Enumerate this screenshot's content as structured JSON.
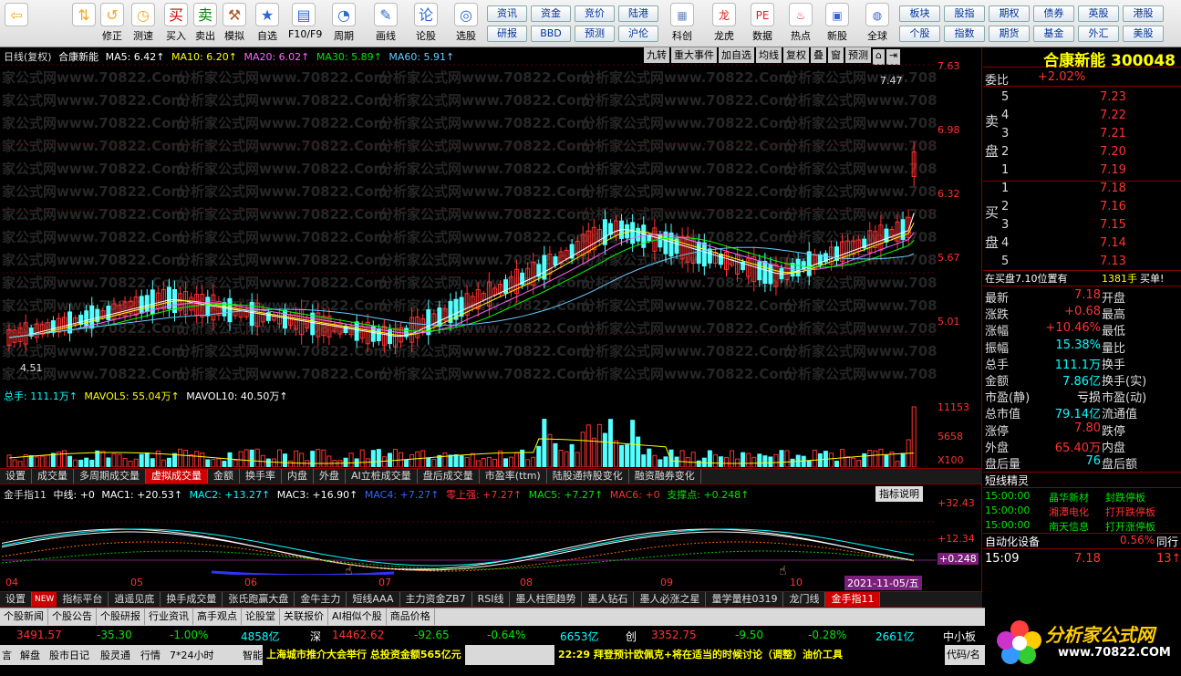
{
  "toolbar": {
    "main_buttons": [
      {
        "label": "",
        "icon": "back-arrow-icon"
      },
      {
        "label": "",
        "icon": "up-down-arrow-icon"
      },
      {
        "label": "修正",
        "icon": "fix-icon"
      },
      {
        "label": "测速",
        "icon": "clock-icon"
      },
      {
        "label": "买入",
        "icon": "buy-icon"
      },
      {
        "label": "卖出",
        "icon": "sell-icon"
      },
      {
        "label": "模拟",
        "icon": "hammer-icon"
      },
      {
        "label": "自选",
        "icon": "star-icon"
      },
      {
        "label": "F10/F9",
        "icon": "f10-icon"
      },
      {
        "label": "周期",
        "icon": "period-icon"
      },
      {
        "label": "画线",
        "icon": "pencil-icon"
      },
      {
        "label": "论股",
        "icon": "discuss-icon"
      },
      {
        "label": "选股",
        "icon": "select-icon"
      }
    ],
    "grid1": [
      [
        "资讯",
        "资金",
        "竞价",
        "陆港"
      ],
      [
        "研报",
        "BBD",
        "预测",
        "沪伦"
      ]
    ],
    "mid_buttons": [
      {
        "label": "科创",
        "icon": "kechuang-icon"
      },
      {
        "label": "龙虎",
        "icon": "dragon-icon"
      },
      {
        "label": "数据",
        "icon": "pe-icon"
      },
      {
        "label": "热点",
        "icon": "hot-icon"
      },
      {
        "label": "新股",
        "icon": "newstock-icon"
      },
      {
        "label": "全球",
        "icon": "globe-icon"
      }
    ],
    "grid2": [
      [
        "板块",
        "股指",
        "期权",
        "债券",
        "英股",
        "港股"
      ],
      [
        "个股",
        "指数",
        "期货",
        "基金",
        "外汇",
        "美股"
      ]
    ]
  },
  "chart_header": {
    "mode": "日线(复权)",
    "name": "合康新能",
    "ma5": "MA5: 6.42↑",
    "ma10": "MA10: 6.20↑",
    "ma20": "MA20: 6.02↑",
    "ma30": "MA30: 5.89↑",
    "ma60": "MA60: 5.91↑"
  },
  "chart_toolbar": [
    "九转",
    "重大事件",
    "加自选",
    "均线",
    "复权",
    "叠",
    "窗",
    "预测"
  ],
  "price_axis": [
    "7.63",
    "6.98",
    "6.32",
    "5.67",
    "5.01"
  ],
  "price_labels": {
    "high": "7.47",
    "low": "4.51"
  },
  "volume_header": {
    "total": "总手: 111.1万↑",
    "mavol5": "MAVOL5: 55.04万↑",
    "mavol10": "MAVOL10: 40.50万↑"
  },
  "volume_axis": [
    "11153",
    "5658",
    "X100"
  ],
  "tabs1": [
    "设置",
    "成交量",
    "多周期成交量",
    "虚拟成交量",
    "金额",
    "换手率",
    "内盘",
    "外盘",
    "AI立桩成交量",
    "盘后成交量",
    "市盈率(ttm)",
    "陆股通持股变化",
    "融资融券变化"
  ],
  "tabs1_active": "虚拟成交量",
  "indicator_header": {
    "name": "金手指11",
    "mid": "中线: +0",
    "mac1": "MAC1: +20.53↑",
    "mac2": "MAC2: +13.27↑",
    "mac3": "MAC3: +16.90↑",
    "mac4": "MAC4: +7.27↑",
    "zero": "零上强: +7.27↑",
    "mac5": "MAC5: +7.27↑",
    "mac6": "MAC6: +0",
    "support": "支撑点: +0.248↑",
    "explain": "指标说明"
  },
  "indicator_axis": [
    "+32.43",
    "+12.34",
    "+0.248"
  ],
  "months": [
    "04",
    "05",
    "06",
    "07",
    "08",
    "09",
    "10"
  ],
  "current_date": "2021-11-05/五",
  "tabs2": [
    "设置",
    "NEW",
    "指标平台",
    "逍遥见底",
    "换手成交量",
    "张氏跑赢大盘",
    "金牛主力",
    "短线AAA",
    "主力资金ZB7",
    "RSI线",
    "墨人柱图趋势",
    "墨人钻石",
    "墨人必涨之星",
    "量学量柱0319",
    "龙门线",
    "金手指11"
  ],
  "tabs2_active": "金手指11",
  "watermark": "分析家公式网www.70822.Com",
  "side": {
    "title": "合康新能",
    "code": "300048",
    "webi_label": "委比",
    "webi": "+2.02%",
    "sell_label": "卖",
    "sell_label2": "盘",
    "sells": [
      {
        "n": "5",
        "p": "7.23"
      },
      {
        "n": "4",
        "p": "7.22"
      },
      {
        "n": "3",
        "p": "7.21"
      },
      {
        "n": "2",
        "p": "7.20"
      },
      {
        "n": "1",
        "p": "7.19"
      }
    ],
    "buy_label": "买",
    "buy_label2": "盘",
    "buys": [
      {
        "n": "1",
        "p": "7.18"
      },
      {
        "n": "2",
        "p": "7.16"
      },
      {
        "n": "3",
        "p": "7.15"
      },
      {
        "n": "4",
        "p": "7.14"
      },
      {
        "n": "5",
        "p": "7.13"
      }
    ],
    "order_text": "在买盘7.10位置有",
    "order_qty": "1381手",
    "order_type": "买单!",
    "quotes": [
      {
        "l": "最新",
        "v": "7.18",
        "r": "开盘",
        "vc": "red"
      },
      {
        "l": "涨跌",
        "v": "+0.68",
        "r": "最高",
        "vc": "red"
      },
      {
        "l": "涨幅",
        "v": "+10.46%",
        "r": "最低",
        "vc": "red"
      },
      {
        "l": "振幅",
        "v": "15.38%",
        "r": "量比",
        "vc": "cyan"
      },
      {
        "l": "总手",
        "v": "111.1万",
        "r": "换手",
        "vc": "cyan"
      },
      {
        "l": "金额",
        "v": "7.86亿",
        "r": "换手(实)",
        "vc": "cyan"
      },
      {
        "l": "市盈(静)",
        "v": "亏损",
        "r": "市盈(动)",
        "vc": "white"
      },
      {
        "l": "总市值",
        "v": "79.14亿",
        "r": "流通值",
        "vc": "cyan"
      },
      {
        "l": "涨停",
        "v": "7.80",
        "r": "跌停",
        "vc": "red"
      },
      {
        "l": "外盘",
        "v": "65.40万",
        "r": "内盘",
        "vc": "red"
      },
      {
        "l": "盘后量",
        "v": "76",
        "r": "盘后额",
        "vc": "cyan"
      }
    ],
    "short_title": "短线精灵",
    "short_list": [
      {
        "t": "15:00:00",
        "n": "晶华新材",
        "e": "封跌停板",
        "c": "green"
      },
      {
        "t": "15:00:00",
        "n": "湘潭电化",
        "e": "打开跌停板",
        "c": "red"
      },
      {
        "t": "15:00:00",
        "n": "南天信息",
        "e": "打开涨停板",
        "c": "green"
      }
    ],
    "auto_label": "自动化设备",
    "auto_val": "0.56%",
    "auto_extra": "同行",
    "tick_time": "15:09",
    "tick_price": "7.18",
    "tick_qty": "13"
  },
  "bottom_tabs": [
    "个股新闻",
    "个股公告",
    "个股研报",
    "行业资讯",
    "高手观点",
    "论股堂",
    "关联报价",
    "AI相似个股",
    "商品价格"
  ],
  "index_bar": [
    {
      "v": "3491.57",
      "c": "red"
    },
    {
      "v": "-35.30",
      "c": "green"
    },
    {
      "v": "-1.00%",
      "c": "green"
    },
    {
      "v": "4858亿",
      "c": "cyan"
    },
    {
      "v": "深",
      "c": "white"
    },
    {
      "v": "14462.62",
      "c": "red"
    },
    {
      "v": "-92.65",
      "c": "green"
    },
    {
      "v": "-0.64%",
      "c": "green"
    },
    {
      "v": "6653亿",
      "c": "cyan"
    },
    {
      "v": "创",
      "c": "white"
    },
    {
      "v": "3352.75",
      "c": "red"
    },
    {
      "v": "-9.50",
      "c": "green"
    },
    {
      "v": "-0.28%",
      "c": "green"
    },
    {
      "v": "2661亿",
      "c": "cyan"
    },
    {
      "v": "中小板指",
      "c": "white"
    }
  ],
  "status_bar": {
    "items": [
      "言",
      "解盘",
      "股市日记",
      "股灵通",
      "行情",
      "7*24小时",
      "智能助手"
    ],
    "news1": "上海城市推介大会举行 总投资金额565亿元",
    "news2": "22:29 拜登预计欧佩克+将在适当的时候讨论（调整）油价工具",
    "code_btn": "代码/名"
  },
  "logo": {
    "text": "分析家公式网",
    "url": "www.70822.COM"
  },
  "colors": {
    "up": "#ff3232",
    "down": "#54ffff",
    "ma5": "#ffffff",
    "ma10": "#ffff00",
    "ma20": "#ff66ff",
    "ma30": "#00ff00",
    "ma60": "#66ccff"
  }
}
